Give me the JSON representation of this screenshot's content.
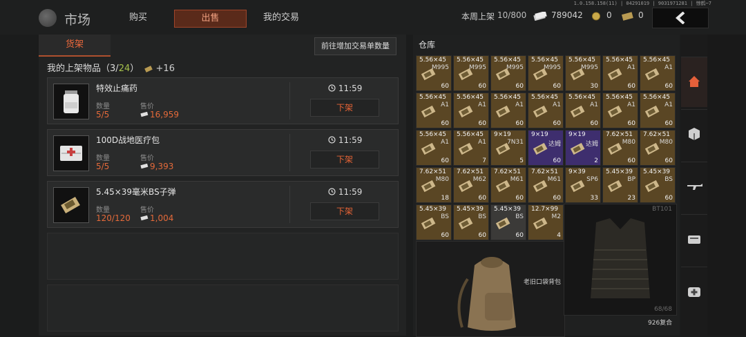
{
  "header": {
    "build_info": "1.0.158.158(11) | 04291019 | 9031971281 | 惊鹤~7",
    "title": "市场",
    "tabs": [
      {
        "label": "购买",
        "active": false
      },
      {
        "label": "出售",
        "active": true
      },
      {
        "label": "我的交易",
        "active": false
      }
    ],
    "weekly_label": "本周上架",
    "weekly_value": "10/800",
    "currency_main": "789042",
    "currency_coin": "0",
    "currency_ticket": "0",
    "back_icon": "chevron-left-icon"
  },
  "shelf": {
    "tab_label": "货架",
    "add_button": "前往增加交易单数量",
    "header_prefix": "我的上架物品（",
    "count_used": "3",
    "count_sep": "/",
    "count_total": "24",
    "header_suffix": "）",
    "bonus": "+16",
    "qty_label": "数量",
    "price_label": "售价",
    "unlist_label": "下架",
    "items": [
      {
        "name": "特效止痛药",
        "qty": "5/5",
        "price": "16,959",
        "time": "11:59"
      },
      {
        "name": "100D战地医疗包",
        "qty": "5/5",
        "price": "9,393",
        "time": "11:59"
      },
      {
        "name": "5.45×39毫米BS子弹",
        "qty": "120/120",
        "price": "1,004",
        "time": "11:59"
      }
    ]
  },
  "warehouse": {
    "title": "仓库",
    "cells": [
      {
        "cal": "5.56×45",
        "sub": "M995",
        "n": "60",
        "c": "gold"
      },
      {
        "cal": "5.56×45",
        "sub": "M995",
        "n": "60",
        "c": "gold"
      },
      {
        "cal": "5.56×45",
        "sub": "M995",
        "n": "60",
        "c": "gold"
      },
      {
        "cal": "5.56×45",
        "sub": "M995",
        "n": "60",
        "c": "gold"
      },
      {
        "cal": "5.56×45",
        "sub": "M995",
        "n": "30",
        "c": "gold"
      },
      {
        "cal": "5.56×45",
        "sub": "A1",
        "n": "60",
        "c": "gold"
      },
      {
        "cal": "5.56×45",
        "sub": "A1",
        "n": "60",
        "c": "gold"
      },
      {
        "cal": "5.56×45",
        "sub": "A1",
        "n": "60",
        "c": "gold"
      },
      {
        "cal": "5.56×45",
        "sub": "A1",
        "n": "60",
        "c": "gold"
      },
      {
        "cal": "5.56×45",
        "sub": "A1",
        "n": "60",
        "c": "gold"
      },
      {
        "cal": "5.56×45",
        "sub": "A1",
        "n": "60",
        "c": "gold"
      },
      {
        "cal": "5.56×45",
        "sub": "A1",
        "n": "60",
        "c": "gold"
      },
      {
        "cal": "5.56×45",
        "sub": "A1",
        "n": "60",
        "c": "gold"
      },
      {
        "cal": "5.56×45",
        "sub": "A1",
        "n": "60",
        "c": "gold"
      },
      {
        "cal": "5.56×45",
        "sub": "A1",
        "n": "60",
        "c": "gold"
      },
      {
        "cal": "5.56×45",
        "sub": "A1",
        "n": "7",
        "c": "gold"
      },
      {
        "cal": "9×19",
        "sub": "7N31",
        "n": "5",
        "c": "gold"
      },
      {
        "cal": "9×19",
        "sub": "达姆",
        "n": "60",
        "c": "purple"
      },
      {
        "cal": "9×19",
        "sub": "达姆",
        "n": "2",
        "c": "purple"
      },
      {
        "cal": "7.62×51",
        "sub": "M80",
        "n": "60",
        "c": "gold"
      },
      {
        "cal": "7.62×51",
        "sub": "M80",
        "n": "60",
        "c": "gold"
      },
      {
        "cal": "7.62×51",
        "sub": "M80",
        "n": "18",
        "c": "gold"
      },
      {
        "cal": "7.62×51",
        "sub": "M62",
        "n": "60",
        "c": "gold"
      },
      {
        "cal": "7.62×51",
        "sub": "M61",
        "n": "60",
        "c": "gold"
      },
      {
        "cal": "7.62×51",
        "sub": "M61",
        "n": "60",
        "c": "gold"
      },
      {
        "cal": "9×39",
        "sub": "SP6",
        "n": "33",
        "c": "gold"
      },
      {
        "cal": "5.45×39",
        "sub": "BP",
        "n": "23",
        "c": "gold"
      },
      {
        "cal": "5.45×39",
        "sub": "BS",
        "n": "60",
        "c": "gold"
      },
      {
        "cal": "5.45×39",
        "sub": "BS",
        "n": "60",
        "c": "gold"
      },
      {
        "cal": "5.45×39",
        "sub": "BS",
        "n": "60",
        "c": "gold"
      },
      {
        "cal": "5.45×39",
        "sub": "BS",
        "n": "60",
        "c": "dark"
      },
      {
        "cal": "12.7×99",
        "sub": "M2",
        "n": "4",
        "c": "gold"
      }
    ],
    "bag_name": "老旧口袋背包",
    "vest_code": "BT101",
    "vest_dur": "68/68",
    "vest_name": "926复合"
  },
  "sidebar": {
    "icons": [
      "home-icon",
      "package-icon",
      "rifle-icon",
      "ammo-box-icon",
      "medkit-icon"
    ]
  },
  "colors": {
    "accent": "#e56a3a",
    "green": "#a6c14b",
    "gold_cell": "#5a4624",
    "purple_cell": "#3e2e6e"
  }
}
